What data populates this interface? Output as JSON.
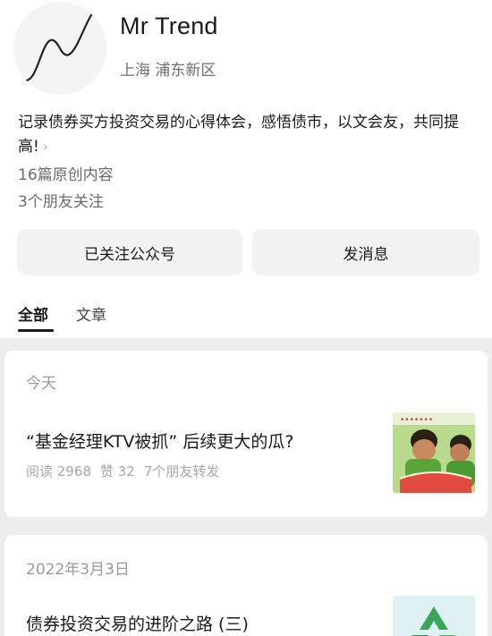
{
  "account": {
    "name": "Mr Trend",
    "location": "上海 浦东新区",
    "bio": "记录债券买方投资交易的心得体会，感悟债市，以文会友，共同提高!",
    "bio_more": "›",
    "original_count_text": "16篇原创内容",
    "friends_following_text": "3个朋友关注"
  },
  "actions": {
    "follow_label": "已关注公众号",
    "message_label": "发消息"
  },
  "tabs": [
    {
      "label": "全部",
      "active": true
    },
    {
      "label": "文章",
      "active": false
    }
  ],
  "feed": [
    {
      "date": "今天",
      "title": "“基金经理KTV被抓” 后续更大的瓜?",
      "reads": "阅读 2968",
      "likes": "赞 32",
      "shares": "7个朋友转发",
      "thumb_icon": "watermelon-eating-photo"
    },
    {
      "date": "2022年3月3日",
      "title": "债券投资交易的进阶之路 (三)",
      "thumb_icon": "green-recycle-photo"
    }
  ],
  "colors": {
    "background": "#ffffff",
    "feed_background": "#ededed",
    "button_background": "#f2f2f2",
    "secondary_text": "#6e6e6e",
    "muted_text": "#a8a8a8"
  }
}
